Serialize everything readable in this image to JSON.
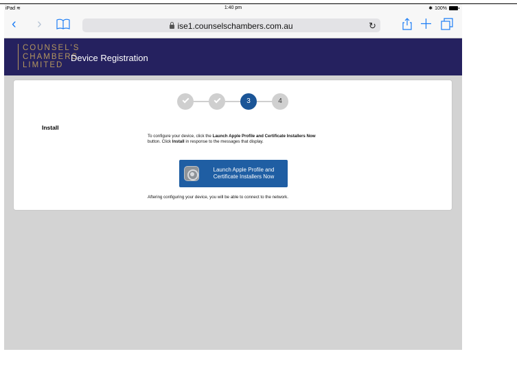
{
  "status_bar": {
    "device": "iPad",
    "time": "1:40 pm",
    "battery": "100%"
  },
  "browser": {
    "url": "ise1.counselschambers.com.au",
    "back_icon": "chevron-left-icon",
    "forward_icon": "chevron-right-icon",
    "bookmarks_icon": "book-icon",
    "reload_icon": "reload-icon",
    "share_icon": "share-icon",
    "new_tab_icon": "plus-icon",
    "tabs_icon": "tabs-icon"
  },
  "header": {
    "logo_line1": "COUNSEL'S",
    "logo_line2": "CHAMBERS",
    "logo_line3": "LIMITED",
    "title": "Device Registration"
  },
  "steps": [
    {
      "label": "",
      "state": "done"
    },
    {
      "label": "",
      "state": "done"
    },
    {
      "label": "3",
      "state": "active"
    },
    {
      "label": "4",
      "state": "todo"
    }
  ],
  "content": {
    "section_title": "Install",
    "desc_pre": "To configure your device, click the ",
    "desc_bold1": "Launch Apple Profile and Certificate Installers Now",
    "desc_mid": " button. Click ",
    "desc_bold2": "Install",
    "desc_post": " in response to the messages that display.",
    "button_label": "Launch Apple Profile and Certificate Installers Now",
    "after_text": "Aftering configuring your device, you will be able to connect to the network."
  },
  "colors": {
    "brand_header": "#25215f",
    "logo_gold": "#b4965e",
    "active_step": "#1b5597",
    "button": "#1f5ea3"
  }
}
